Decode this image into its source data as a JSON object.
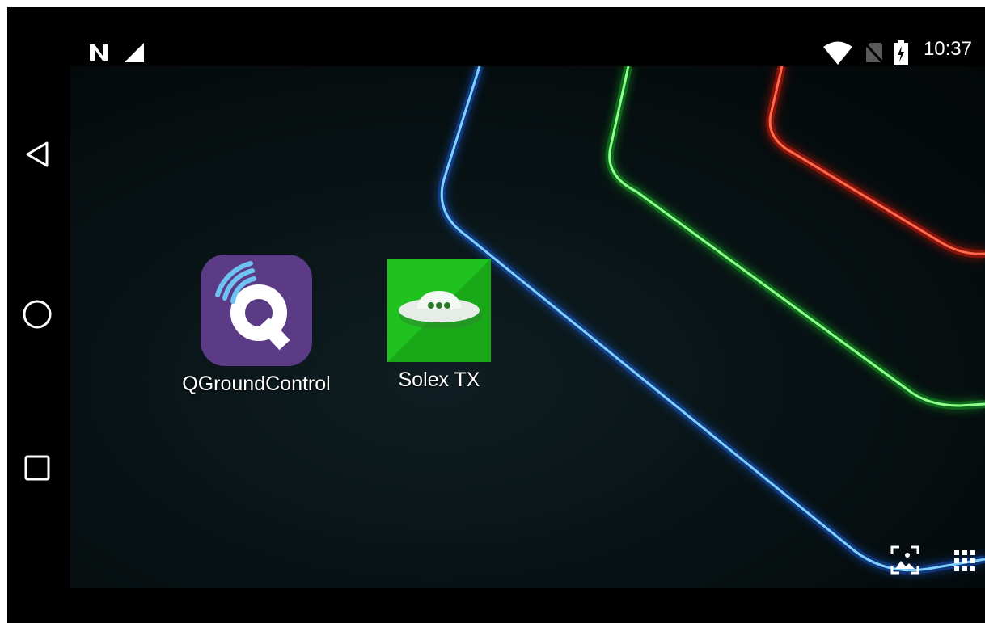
{
  "status_bar": {
    "time": "10:37",
    "icons": [
      "nfc-icon",
      "cell-signal-icon",
      "wifi-icon",
      "no-sim-icon",
      "battery-charging-icon"
    ]
  },
  "navigation": {
    "buttons": [
      "back-icon",
      "home-icon",
      "recents-icon"
    ]
  },
  "home": {
    "apps": [
      {
        "label": "QGroundControl",
        "icon": "qgroundcontrol-app-icon"
      },
      {
        "label": "Solex TX",
        "icon": "solex-tx-app-icon"
      }
    ],
    "corner_buttons": [
      "wallpaper-icon",
      "app-drawer-icon"
    ]
  },
  "colors": {
    "neon_blue": "#3aa0ff",
    "neon_green": "#27e03a",
    "neon_red": "#ff2a1a",
    "qgc_purple": "#5b3a86",
    "solex_green": "#1fc21f"
  }
}
